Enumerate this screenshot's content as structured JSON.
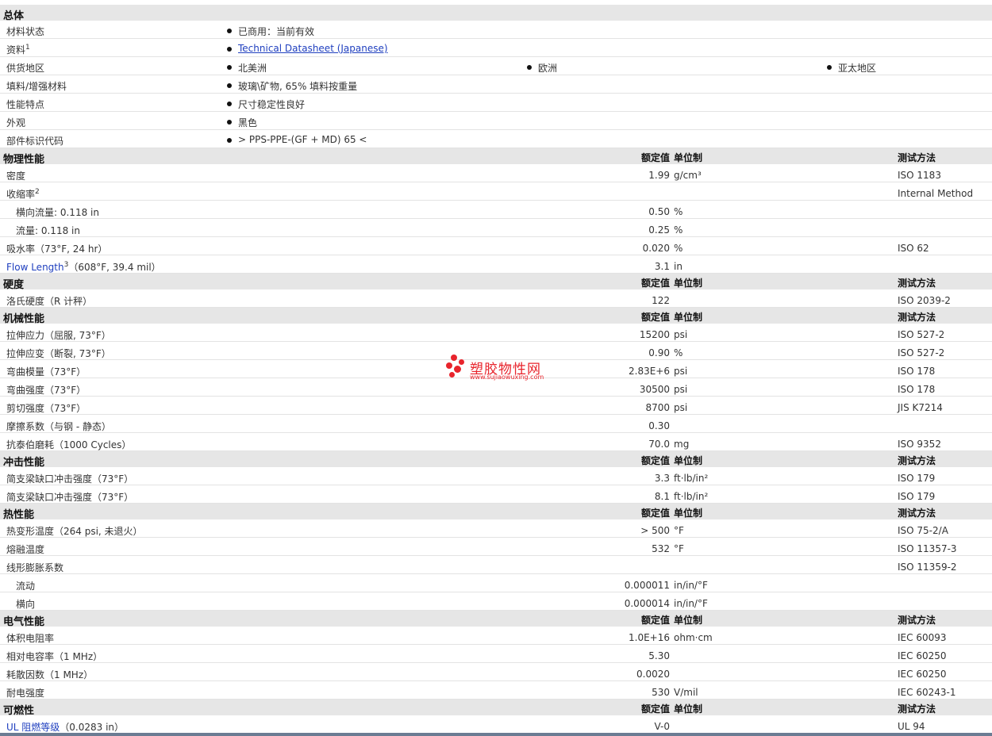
{
  "general": {
    "title": "总体",
    "rows": [
      {
        "label": "材料状态",
        "values": [
          "已商用：当前有效"
        ]
      },
      {
        "label": "资料",
        "sup": "1",
        "values": [
          "Technical Datasheet (Japanese)"
        ],
        "link": true
      },
      {
        "label": "供货地区",
        "values": [
          "北美洲",
          "欧洲",
          "亚太地区"
        ]
      },
      {
        "label": "填料/增强材料",
        "values": [
          "玻璃\\矿物, 65% 填料按重量"
        ]
      },
      {
        "label": "性能特点",
        "values": [
          "尺寸稳定性良好"
        ]
      },
      {
        "label": "外观",
        "values": [
          "黑色"
        ]
      },
      {
        "label": "部件标识代码",
        "values": [
          "> PPS-PPE-(GF + MD) 65 <"
        ]
      }
    ]
  },
  "headers": {
    "nominal": "额定值",
    "unit": "单位制",
    "test": "测试方法"
  },
  "sections": [
    {
      "title": "物理性能",
      "rows": [
        {
          "label": "密度",
          "nominal": "1.99",
          "unit": "g/cm³",
          "test": "ISO 1183"
        },
        {
          "label": "收缩率",
          "sup": "2",
          "nominal": "",
          "unit": "",
          "test": "Internal Method"
        },
        {
          "label": "横向流量: 0.118 in",
          "indent": true,
          "nominal": "0.50",
          "unit": "%",
          "test": ""
        },
        {
          "label": "流量: 0.118 in",
          "indent": true,
          "nominal": "0.25",
          "unit": "%",
          "test": ""
        },
        {
          "label": "吸水率（73°F, 24 hr）",
          "nominal": "0.020",
          "unit": "%",
          "test": "ISO 62"
        },
        {
          "label": "Flow Length",
          "sup": "3",
          "label_suffix": "（608°F, 39.4 mil）",
          "blue": true,
          "nominal": "3.1",
          "unit": "in",
          "test": ""
        }
      ]
    },
    {
      "title": "硬度",
      "rows": [
        {
          "label": "洛氏硬度（R 计秤）",
          "nominal": "122",
          "unit": "",
          "test": "ISO 2039-2"
        }
      ]
    },
    {
      "title": "机械性能",
      "rows": [
        {
          "label": "拉伸应力（屈服, 73°F）",
          "nominal": "15200",
          "unit": "psi",
          "test": "ISO 527-2"
        },
        {
          "label": "拉伸应变（断裂, 73°F）",
          "nominal": "0.90",
          "unit": "%",
          "test": "ISO 527-2"
        },
        {
          "label": "弯曲模量（73°F）",
          "nominal": "2.83E+6",
          "unit": "psi",
          "test": "ISO 178"
        },
        {
          "label": "弯曲强度（73°F）",
          "nominal": "30500",
          "unit": "psi",
          "test": "ISO 178"
        },
        {
          "label": "剪切强度（73°F）",
          "nominal": "8700",
          "unit": "psi",
          "test": "JIS K7214"
        },
        {
          "label": "摩擦系数（与钢 - 静态）",
          "nominal": "0.30",
          "unit": "",
          "test": ""
        },
        {
          "label": "抗泰伯磨耗（1000 Cycles）",
          "nominal": "70.0",
          "unit": "mg",
          "test": "ISO 9352"
        }
      ]
    },
    {
      "title": "冲击性能",
      "rows": [
        {
          "label": "简支梁缺口冲击强度（73°F）",
          "nominal": "3.3",
          "unit": "ft·lb/in²",
          "test": "ISO 179"
        },
        {
          "label": "简支梁缺口冲击强度（73°F）",
          "nominal": "8.1",
          "unit": "ft·lb/in²",
          "test": "ISO 179"
        }
      ]
    },
    {
      "title": "热性能",
      "rows": [
        {
          "label": "热变形温度（264 psi, 未退火）",
          "nominal": "> 500",
          "unit": "°F",
          "test": "ISO 75-2/A"
        },
        {
          "label": "熔融温度",
          "nominal": "532",
          "unit": "°F",
          "test": "ISO 11357-3"
        },
        {
          "label": "线形膨胀系数",
          "nominal": "",
          "unit": "",
          "test": "ISO 11359-2"
        },
        {
          "label": "流动",
          "indent": true,
          "nominal": "0.000011",
          "unit": "in/in/°F",
          "test": ""
        },
        {
          "label": "横向",
          "indent": true,
          "nominal": "0.000014",
          "unit": "in/in/°F",
          "test": ""
        }
      ]
    },
    {
      "title": "电气性能",
      "rows": [
        {
          "label": "体积电阻率",
          "nominal": "1.0E+16",
          "unit": "ohm·cm",
          "test": "IEC 60093"
        },
        {
          "label": "相对电容率（1 MHz）",
          "nominal": "5.30",
          "unit": "",
          "test": "IEC 60250"
        },
        {
          "label": "耗散因数（1 MHz）",
          "nominal": "0.0020",
          "unit": "",
          "test": "IEC 60250"
        },
        {
          "label": "耐电强度",
          "nominal": "530",
          "unit": "V/mil",
          "test": "IEC 60243-1"
        }
      ]
    },
    {
      "title": "可燃性",
      "rows": [
        {
          "label": "UL 阻燃等级",
          "label_suffix": "（0.0283 in）",
          "blue": true,
          "nominal": "V-0",
          "unit": "",
          "test": "UL 94"
        }
      ]
    }
  ],
  "watermark": {
    "title": "塑胶物性网",
    "url": "www.sujiaowuxing.com"
  },
  "colors": {
    "section_bg": "#e6e6e6",
    "link": "#1f3fbf",
    "watermark": "#e8242c"
  }
}
